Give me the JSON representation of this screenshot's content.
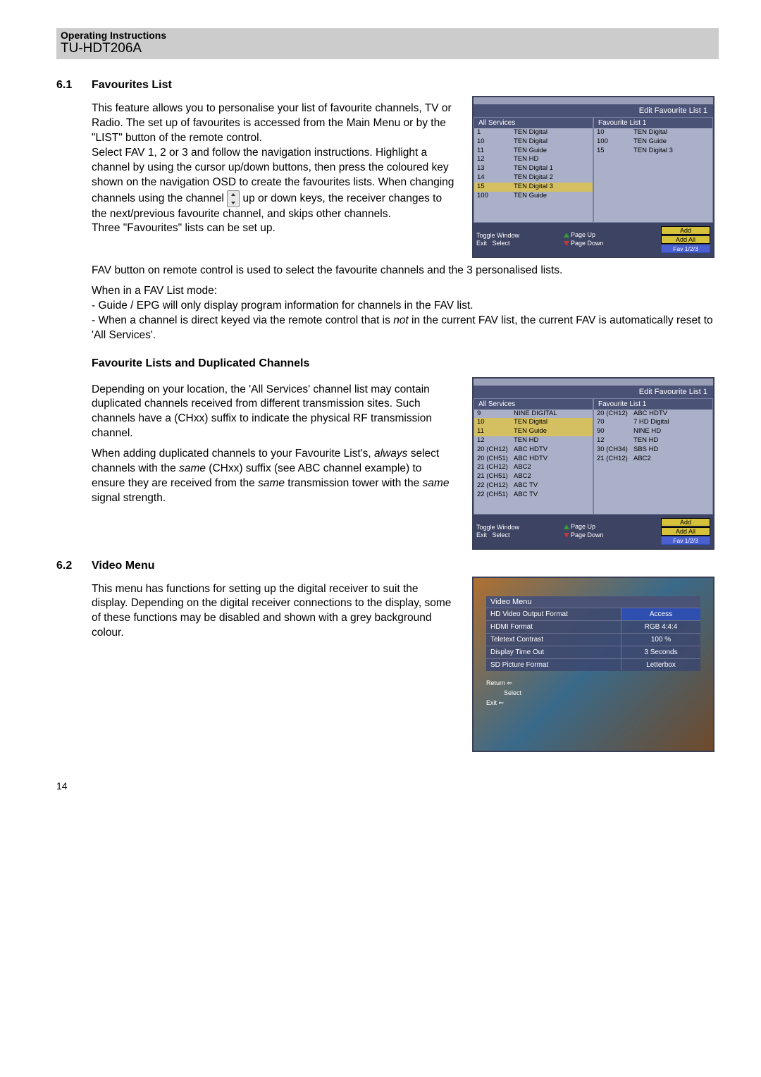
{
  "header": {
    "operating_instructions": "Operating Instructions",
    "model": "TU-HDT206A"
  },
  "section_6_1": {
    "num": "6.1",
    "title": "Favourites List",
    "p1a": "This feature allows you to personalise your list of favourite channels, TV or Radio. The set up of favourites is accessed from the Main Menu or by the \"LIST\" button of the remote control.",
    "p1b_before_icon": "Select FAV 1, 2 or 3 and follow the navigation instructions. Highlight a channel by using the cursor up/down buttons, then press the coloured key shown on the navigation OSD to create the favourites lists. When changing channels using the channel ",
    "p1b_after_icon": " up or down keys, the receiver changes to the next/previous favourite channel, and skips other channels.",
    "p1c": "Three \"Favourites\" lists can be set up.",
    "p2": "FAV button on remote control is used to select the favourite channels and the 3 personalised lists.",
    "p3": "When in a FAV List mode:",
    "p4": "- Guide / EPG will only display program information for channels in the FAV list.",
    "p5a": "- When a channel is direct keyed via the remote control that is ",
    "p5_not": "not",
    "p5b": " in the current FAV list, the current FAV is automatically reset to 'All Services'."
  },
  "sub_heading": "Favourite Lists and Duplicated Channels",
  "dup": {
    "p1": "Depending on your location, the 'All Services' channel list may contain duplicated channels received from different transmission sites. Such channels have a (CHxx) suffix to indicate the physical RF transmission channel.",
    "p2a": "When adding duplicated channels to your Favourite List's, ",
    "p2_always": "always",
    "p2b": " select channels with the ",
    "p2_same1": "same",
    "p2c": " (CHxx) suffix (see ABC channel example) to ensure they are received from the ",
    "p2_same2": "same",
    "p2d": " transmission tower with the ",
    "p2_same3": "same",
    "p2e": " signal strength."
  },
  "section_6_2": {
    "num": "6.2",
    "title": "Video Menu",
    "p1": "This menu has functions for setting up the digital receiver to suit the display. Depending on the digital receiver connections to the display, some of these functions may be disabled and shown with a grey background colour."
  },
  "page_number": "14",
  "osd1": {
    "title": "Edit Favourite List 1",
    "col1_hdr": "All Services",
    "col2_hdr": "Favourite List 1",
    "col1": [
      {
        "n": "1",
        "name": "TEN Digital"
      },
      {
        "n": "10",
        "name": "TEN Digital"
      },
      {
        "n": "11",
        "name": "TEN Guide"
      },
      {
        "n": "12",
        "name": "TEN HD"
      },
      {
        "n": "13",
        "name": "TEN Digital 1"
      },
      {
        "n": "14",
        "name": "TEN Digital 2"
      },
      {
        "n": "15",
        "name": "TEN Digital 3",
        "sel": true
      },
      {
        "n": "100",
        "name": "TEN Guide"
      }
    ],
    "col2": [
      {
        "n": "10",
        "name": "TEN Digital"
      },
      {
        "n": "100",
        "name": "TEN Guide"
      },
      {
        "n": "15",
        "name": "TEN Digital 3"
      }
    ],
    "nav": {
      "toggle": "Toggle Window",
      "exit": "Exit",
      "select": "Select",
      "pageup": "Page Up",
      "pagedown": "Page Down",
      "add": "Add",
      "addall": "Add All",
      "fav": "Fav 1/2/3"
    }
  },
  "osd2": {
    "title": "Edit Favourite List 1",
    "col1_hdr": "All Services",
    "col2_hdr": "Favourite List 1",
    "col1": [
      {
        "n": "9",
        "name": "NINE DIGITAL"
      },
      {
        "n": "10",
        "name": "TEN Digital",
        "sel": true
      },
      {
        "n": "11",
        "name": "TEN Guide",
        "sel": true
      },
      {
        "n": "12",
        "name": "TEN HD"
      },
      {
        "n": "20 (CH12)",
        "name": "ABC HDTV"
      },
      {
        "n": "20 (CH51)",
        "name": "ABC HDTV"
      },
      {
        "n": "21 (CH12)",
        "name": "ABC2"
      },
      {
        "n": "21 (CH51)",
        "name": "ABC2"
      },
      {
        "n": "22 (CH12)",
        "name": "ABC TV"
      },
      {
        "n": "22 (CH51)",
        "name": "ABC TV"
      }
    ],
    "col2": [
      {
        "n": "20 (CH12)",
        "name": "ABC HDTV"
      },
      {
        "n": "70",
        "name": "7 HD Digital"
      },
      {
        "n": "90",
        "name": "NINE HD"
      },
      {
        "n": "12",
        "name": "TEN HD"
      },
      {
        "n": "30 (CH34)",
        "name": "SBS HD"
      },
      {
        "n": "21 (CH12)",
        "name": "ABC2"
      }
    ]
  },
  "video_menu": {
    "title": "Video Menu",
    "rows": [
      {
        "label": "HD Video Output Format",
        "value": "Access",
        "sel": true
      },
      {
        "label": "HDMI Format",
        "value": "RGB 4:4:4"
      },
      {
        "label": "Teletext Contrast",
        "value": "100 %"
      },
      {
        "label": "Display Time Out",
        "value": "3 Seconds"
      },
      {
        "label": "SD Picture Format",
        "value": "Letterbox"
      }
    ],
    "nav": {
      "return": "Return",
      "select": "Select",
      "exit": "Exit"
    }
  }
}
